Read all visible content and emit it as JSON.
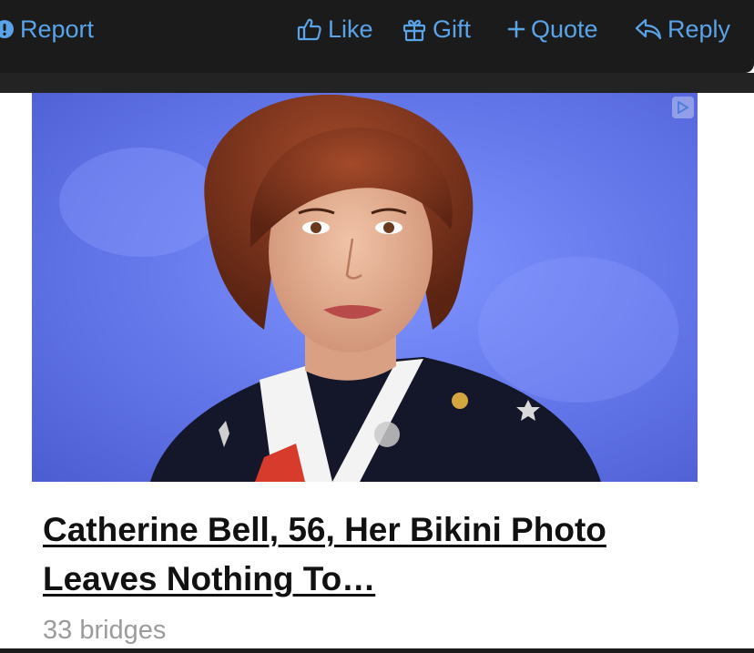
{
  "toolbar": {
    "report_label": "Report",
    "like_label": "Like",
    "gift_label": "Gift",
    "quote_label": "Quote",
    "reply_label": "Reply",
    "accent_color": "#5aa3e8",
    "background_color": "#1b1b1b"
  },
  "ad": {
    "headline": "Catherine Bell, 56, Her Bikini Photo Leaves Nothing To…",
    "source": "33 bridges",
    "image_icon": "adchoices-icon"
  }
}
